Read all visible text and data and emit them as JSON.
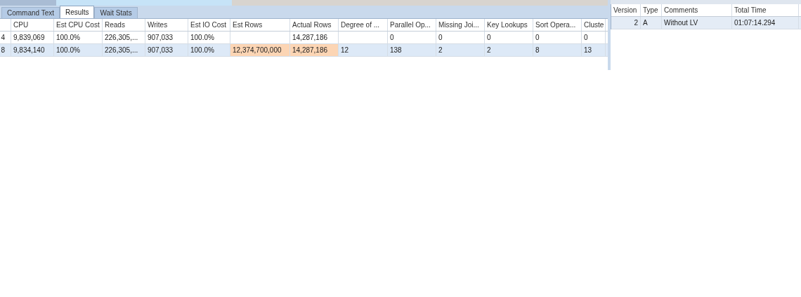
{
  "tabs": [
    {
      "label": "Command Text",
      "selected": false
    },
    {
      "label": "Results",
      "selected": true
    },
    {
      "label": "Wait Stats",
      "selected": false
    }
  ],
  "results_grid": {
    "columns": [
      "CPU",
      "Est CPU Cost",
      "Reads",
      "Writes",
      "Est IO Cost",
      "Est Rows",
      "Actual Rows",
      "Degree of ...",
      "Parallel Op...",
      "Missing Joi...",
      "Key Lookups",
      "Sort Opera...",
      "Cluste"
    ],
    "rows": [
      {
        "column_1": "4",
        "selected": false,
        "cells": [
          {
            "text": "9,839,069",
            "highlighted": false
          },
          {
            "text": "100.0%",
            "highlighted": false
          },
          {
            "text": "226,305,...",
            "highlighted": false
          },
          {
            "text": "907,033",
            "highlighted": false
          },
          {
            "text": "100.0%",
            "highlighted": false
          },
          {
            "highlighted": false
          },
          {
            "text": "14,287,186",
            "highlighted": false
          },
          {
            "highlighted": false
          },
          {
            "text": "0",
            "highlighted": false
          },
          {
            "text": "0",
            "highlighted": false
          },
          {
            "text": "0",
            "highlighted": false
          },
          {
            "text": "0",
            "highlighted": false
          },
          {
            "text": "0",
            "highlighted": false
          }
        ]
      },
      {
        "column_1": "8",
        "selected": true,
        "cells": [
          {
            "text": "9,834,140",
            "highlighted": false
          },
          {
            "text": "100.0%",
            "highlighted": false
          },
          {
            "text": "226,305,...",
            "highlighted": false
          },
          {
            "text": "907,033",
            "highlighted": false
          },
          {
            "text": "100.0%",
            "highlighted": false
          },
          {
            "text": "12,374,700,000",
            "highlighted": true
          },
          {
            "text": "14,287,186",
            "highlighted": true
          },
          {
            "text": "12",
            "highlighted": false
          },
          {
            "text": "138",
            "highlighted": false
          },
          {
            "text": "2",
            "highlighted": false
          },
          {
            "text": "2",
            "highlighted": false
          },
          {
            "text": "8",
            "highlighted": false
          },
          {
            "text": "13",
            "highlighted": false
          }
        ]
      }
    ]
  },
  "versions_grid": {
    "columns": [
      "Version",
      "Type",
      "Comments",
      "Total Time"
    ],
    "rows": [
      {
        "selected": true,
        "cells": [
          "2",
          "A",
          "Without LV",
          "01:07:14.294"
        ]
      }
    ]
  }
}
